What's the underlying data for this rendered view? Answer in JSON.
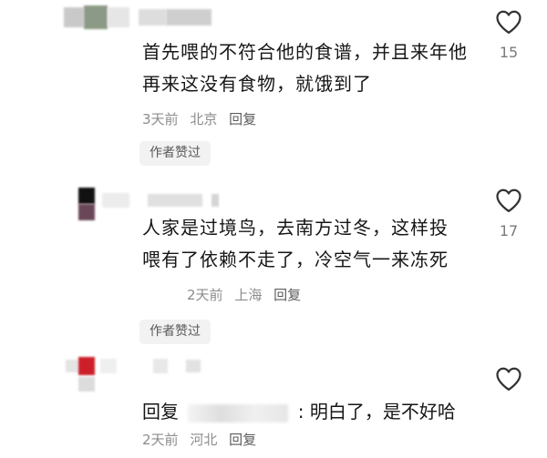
{
  "comments": [
    {
      "text": "首先喂的不符合他的食谱，并且来年他再来这没有食物，就饿到了",
      "time": "3天前",
      "location": "北京",
      "reply": "回复",
      "badge": "作者赞过",
      "likes": "15"
    },
    {
      "text": "人家是过境鸟，去南方过冬，这样投喂有了依赖不走了，冷空气一来冻死",
      "time": "2天前",
      "location": "上海",
      "reply": "回复",
      "badge": "作者赞过",
      "likes": "17"
    },
    {
      "reply_prefix": "回复",
      "text": ": 明白了，是不好哈",
      "time": "2天前",
      "location": "河北",
      "reply": "回复"
    }
  ],
  "icons": {
    "like": "heart-outline-icon"
  },
  "colors": {
    "meta": "#8c8c8c",
    "badge_bg": "#f2f2f2",
    "text": "#161616"
  }
}
